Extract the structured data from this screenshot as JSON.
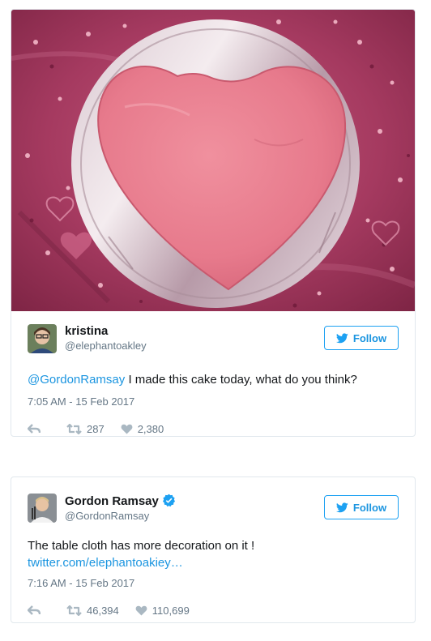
{
  "tweets": [
    {
      "display_name": "kristina",
      "handle": "@elephantoakley",
      "follow_label": "Follow",
      "mention": "@GordonRamsay",
      "text": " I made this cake today, what do you think?",
      "timestamp": "7:05 AM - 15 Feb 2017",
      "retweets": "287",
      "likes": "2,380",
      "icons": [
        "reply-icon",
        "retweet-icon",
        "heart-icon",
        "twitter-bird-icon"
      ],
      "has_photo": true
    },
    {
      "display_name": "Gordon Ramsay",
      "handle": "@GordonRamsay",
      "verified": true,
      "follow_label": "Follow",
      "text": "The table cloth has more decoration on it !",
      "link": "twitter.com/elephantoakiey…",
      "timestamp": "7:16 AM - 15 Feb 2017",
      "retweets": "46,394",
      "likes": "110,699",
      "icons": [
        "reply-icon",
        "retweet-icon",
        "heart-icon",
        "twitter-bird-icon",
        "verified-badge-icon"
      ]
    }
  ],
  "colors": {
    "accent": "#1da1f2",
    "link": "#1b95e0",
    "secondary_text": "#657786",
    "border": "#e1e8ed",
    "cake_pink": "#e8788a",
    "tablecloth": "#a8335a"
  }
}
